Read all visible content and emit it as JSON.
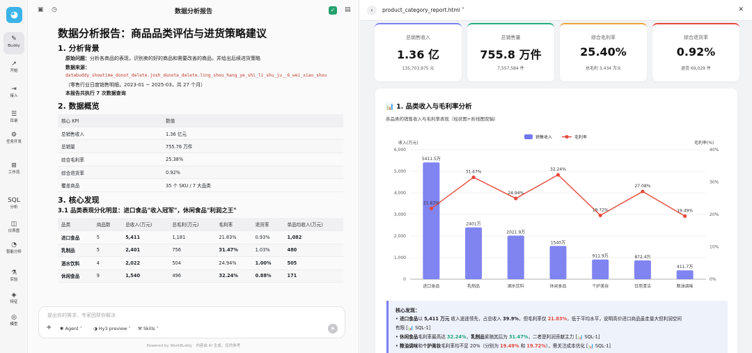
{
  "rail": {
    "logo": "◕",
    "items": [
      {
        "label": "Buddy",
        "icon": "✎"
      },
      {
        "label": "开始",
        "icon": "↗"
      },
      {
        "label": "接入",
        "icon": "⇥"
      },
      {
        "label": "目录",
        "icon": "☰"
      },
      {
        "label": "任务开发",
        "icon": "⚙"
      },
      {
        "label": "工作流",
        "icon": "⊞"
      },
      {
        "label": "分析",
        "icon": "SQL"
      },
      {
        "label": "仪表盘",
        "icon": "◫"
      },
      {
        "label": "智能分析",
        "icon": "◔"
      },
      {
        "label": "实验",
        "icon": "⚗"
      },
      {
        "label": "特征",
        "icon": "◈"
      },
      {
        "label": "模型",
        "icon": "◎"
      }
    ]
  },
  "chat": {
    "title": "数据分析报告",
    "doc": {
      "h1": "数据分析报告：商品品类评估与进货策略建议",
      "s1": "1. 分析背景",
      "problem_label": "原始问题：",
      "problem": "分析各商品的表现，识别卖的好的商品和需要改善的商品，并给出后续进货策略",
      "source_label": "数据来源：",
      "source_code": "databuddy_showtime_donot_delete.josh_donote_delete.ling_shou_hang_ye_shi_li_shu_ju__6_wei_xiao_shou",
      "source_note": "（零售行业日度销售明细，2023-01 ~ 2025-03，共 27 个月）",
      "queries": "本报告共执行 7 次数据查询",
      "s2": "2. 数据概览",
      "kpi_headers": [
        "核心 KPI",
        "数值"
      ],
      "kpi_rows": [
        [
          "总销售收入",
          "1.36 亿元"
        ],
        [
          "总销量",
          "755.76 万件"
        ],
        [
          "综合毛利率",
          "25.38%"
        ],
        [
          "综合退货率",
          "0.92%"
        ],
        [
          "覆盖商品",
          "35 个 SKU / 7 大品类"
        ]
      ],
      "s3": "3. 核心发现",
      "s31": "3.1 品类表现分化明显：进口食品\"收入冠军\"，休闲食品\"利润之王\"",
      "cat_headers": [
        "品类",
        "商品数",
        "总收入(万元)",
        "总毛利(万元)",
        "毛利率",
        "退货率",
        "单品均收入(万元)"
      ],
      "cat_rows": [
        [
          "进口食品",
          "5",
          "5,411",
          "1,181",
          "21.83%",
          "0.93%",
          "1,082"
        ],
        [
          "乳制品",
          "5",
          "2,401",
          "756",
          "31.47%",
          "1.03%",
          "480"
        ],
        [
          "酒水饮料",
          "4",
          "2,022",
          "504",
          "24.94%",
          "1.00%",
          "505"
        ],
        [
          "休闲食品",
          "9",
          "1,540",
          "496",
          "32.24%",
          "0.88%",
          "171"
        ]
      ]
    },
    "composer": {
      "placeholder": "提出你的需求，专家团帮你解决",
      "agent": "Agent",
      "model": "Hy3 preview",
      "skills": "Skills"
    },
    "powered": "Powered by WorkBuddy　内容由 AI 生成，仅供参考"
  },
  "report": {
    "file": "product_category_report.html",
    "kpis": [
      {
        "label": "总销售收入",
        "value": "1.36 亿",
        "sub": "135,703,975 元",
        "color": "#7b7ff2"
      },
      {
        "label": "总销售量",
        "value": "755.8 万件",
        "sub": "7,557,584 件",
        "color": "#22b07d"
      },
      {
        "label": "综合毛利率",
        "value": "25.40%",
        "sub": "总毛利 3,434 万元",
        "color": "#f0a33c"
      },
      {
        "label": "综合退货率",
        "value": "0.92%",
        "sub": "退货 69,029 件",
        "color": "#e5483a"
      }
    ],
    "chart_title": "📊 1. 品类收入与毛利率分析",
    "chart_sub": "各品类的销售收入与毛利率表现（柱状图+折线图双轴）",
    "findings": {
      "title": "核心发现：",
      "l1_pre": "• ",
      "l1_name": "进口食品",
      "l1_a": "以 ",
      "l1_val": "5,411 万元",
      "l1_b": " 收入遥遥领先，占总收入 ",
      "l1_share": "39.9%",
      "l1_c": "，但毛利率仅 ",
      "l1_margin": "21.83%",
      "l1_d": "，低于平均水平，说明高价进口商品虽走量大但利润空间",
      "l1_e": "有限 [📊 SQL-1]",
      "l2_name": "休闲食品",
      "l2_a": "毛利率最高达 ",
      "l2_m1": "32.24%",
      "l2_b": "，",
      "l2_name2": "乳制品",
      "l2_c": "紧随其后为 ",
      "l2_m2": "31.47%",
      "l2_d": "，二者是利润贡献主力 [📊 SQL-1]",
      "l3_name": "粮油调味",
      "l3_a": "和",
      "l3_name2": "个护美妆",
      "l3_b": "毛利率均不足 20%（分别为 ",
      "l3_m1": "19.49%",
      "l3_c": " 和 ",
      "l3_m2": "19.72%",
      "l3_d": "），需关注成本优化 [📊 SQL-1]"
    }
  },
  "chart_data": {
    "type": "bar",
    "categories": [
      "进口食品",
      "乳制品",
      "酒水饮料",
      "休闲食品",
      "个护美妆",
      "日用清洁",
      "粮油调味"
    ],
    "series": [
      {
        "name": "销售收入",
        "type": "bar",
        "values": [
          5411.5,
          2401,
          2021.9,
          1540,
          911.9,
          872.4,
          411.7
        ],
        "labels": [
          "5411.5万",
          "2401万",
          "2021.9万",
          "1540万",
          "911.9万",
          "872.4万",
          "411.7万"
        ],
        "axis": "left",
        "color": "#7277f0"
      },
      {
        "name": "毛利率",
        "type": "line",
        "values": [
          21.83,
          31.47,
          24.94,
          32.24,
          19.72,
          27.08,
          19.49
        ],
        "labels": [
          "21.83%",
          "31.47%",
          "24.94%",
          "32.24%",
          "19.72%",
          "27.08%",
          "19.49%"
        ],
        "axis": "right",
        "color": "#e5483a"
      }
    ],
    "ylabel": "收入(万元)",
    "y2label": "毛利率(%)",
    "ylim": [
      0,
      6000
    ],
    "y2lim": [
      0,
      40
    ],
    "yticks": [
      "0",
      "1,000",
      "2,000",
      "3,000",
      "4,000",
      "5,000",
      "6,000"
    ],
    "y2ticks": [
      "0%",
      "10%",
      "20%",
      "30%",
      "40%"
    ],
    "legend": "top-center",
    "grid": true
  }
}
